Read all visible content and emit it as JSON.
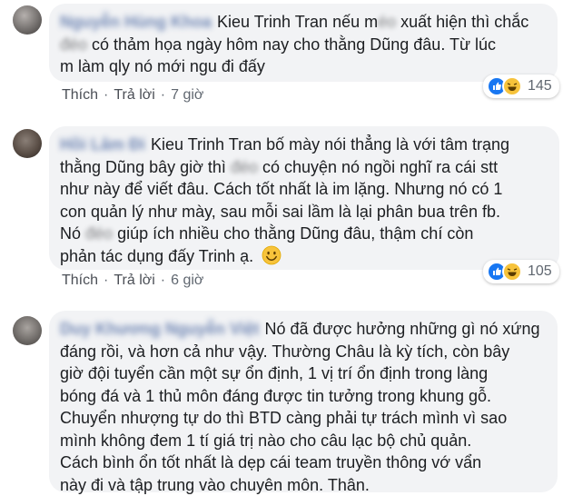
{
  "comments": [
    {
      "author": "Nguyễn Hùng Khoa",
      "lines": [
        {
          "mention": "Kieu Trinh Tran",
          "text": " nếu m",
          "blur": "éo",
          "tail": " xuất hiện thì chắc"
        },
        {
          "blur": "đéo",
          "text": " có thảm họa ngày hôm nay cho thằng Dũng đâu. Từ lúc"
        },
        {
          "text": "m làm qly nó mới ngu đi đấy"
        }
      ],
      "like_label": "Thích",
      "reply_label": "Trả lời",
      "time": "7 giờ",
      "reaction_count": "145"
    },
    {
      "author": "Hồi Lâm Đi",
      "lines": [
        {
          "mention": "Kieu Trinh Tran",
          "text": " bố mày nói thẳng là với tâm trạng"
        },
        {
          "text": "thằng Dũng bây giờ thì ",
          "blur": "đéo",
          "tail": " có chuyện nó ngồi nghĩ ra cái stt"
        },
        {
          "text": "như này để viết đâu. Cách tốt nhất là im lặng. Nhưng nó có 1"
        },
        {
          "text": "con quản lý như mày, sau mỗi sai lầm là lại phân bua trên fb."
        },
        {
          "text": "Nó ",
          "blur": "đéo",
          "tail": " giúp ích nhiều cho thằng Dũng đâu, thậm chí còn"
        },
        {
          "text": "phản tác dụng đấy Trinh ạ."
        }
      ],
      "like_label": "Thích",
      "reply_label": "Trả lời",
      "time": "6 giờ",
      "reaction_count": "105"
    },
    {
      "author": "Duy Khương Nguyễn Việt",
      "lines": [
        {
          "text": "Nó đã được hưởng những gì nó xứng"
        },
        {
          "text": "đáng rồi, và hơn cả như vậy. Thường Châu là kỳ tích, còn bây"
        },
        {
          "text": "giờ đội tuyển cần một sự ổn định, 1 vị trí ổn định trong làng"
        },
        {
          "text": "bóng đá và 1 thủ môn đáng được tin tưởng trong khung gỗ."
        },
        {
          "text": "Chuyển nhượng tự do thì BTD càng phải tự trách mình vì sao"
        },
        {
          "text": "mình không đem 1 tí giá trị nào cho câu lạc bộ chủ quản."
        },
        {
          "text": "Cách bình ổn tốt nhất là dẹp cái team truyền thông vớ vẩn"
        },
        {
          "text": "này đi và tập trung vào chuyên môn. Thân."
        }
      ]
    }
  ],
  "colors": {
    "bubble": "#f2f3f5",
    "link": "#385898",
    "meta": "#606770",
    "like_blue": "#1877f2",
    "haha_yellow": "#f7c33b"
  }
}
